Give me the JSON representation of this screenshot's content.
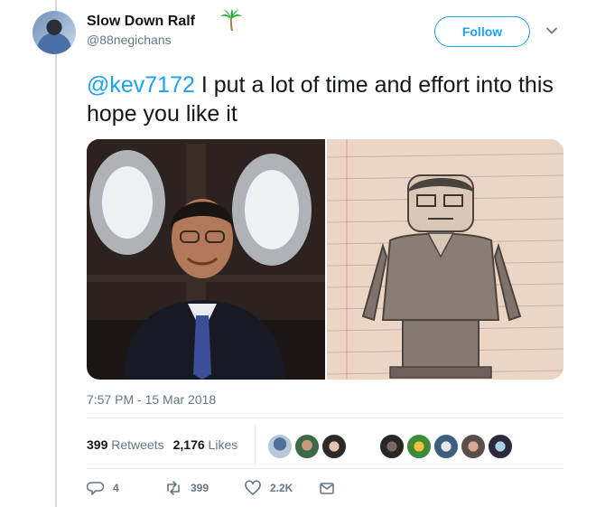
{
  "header": {
    "display_name": "Slow Down Ralf",
    "handle": "@88negichans",
    "follow_label": "Follow",
    "badge_icon": "palm-tree-icon",
    "menu_icon": "chevron-down-icon"
  },
  "tweet": {
    "mention": "@kev7172",
    "text": " I put a lot of time and effort into this hope you like it"
  },
  "media": {
    "items": [
      {
        "icon": "photo-icon"
      },
      {
        "icon": "drawing-icon"
      }
    ]
  },
  "meta": {
    "timestamp": "7:57 PM - 15 Mar 2018"
  },
  "stats": {
    "retweets_count": "399",
    "retweets_label": "Retweets",
    "likes_count": "2,176",
    "likes_label": "Likes"
  },
  "actions": {
    "reply_count": "4",
    "retweet_count": "399",
    "like_count": "2.2K"
  },
  "colors": {
    "accent": "#1da1f2",
    "muted": "#657786",
    "text": "#14171a"
  }
}
